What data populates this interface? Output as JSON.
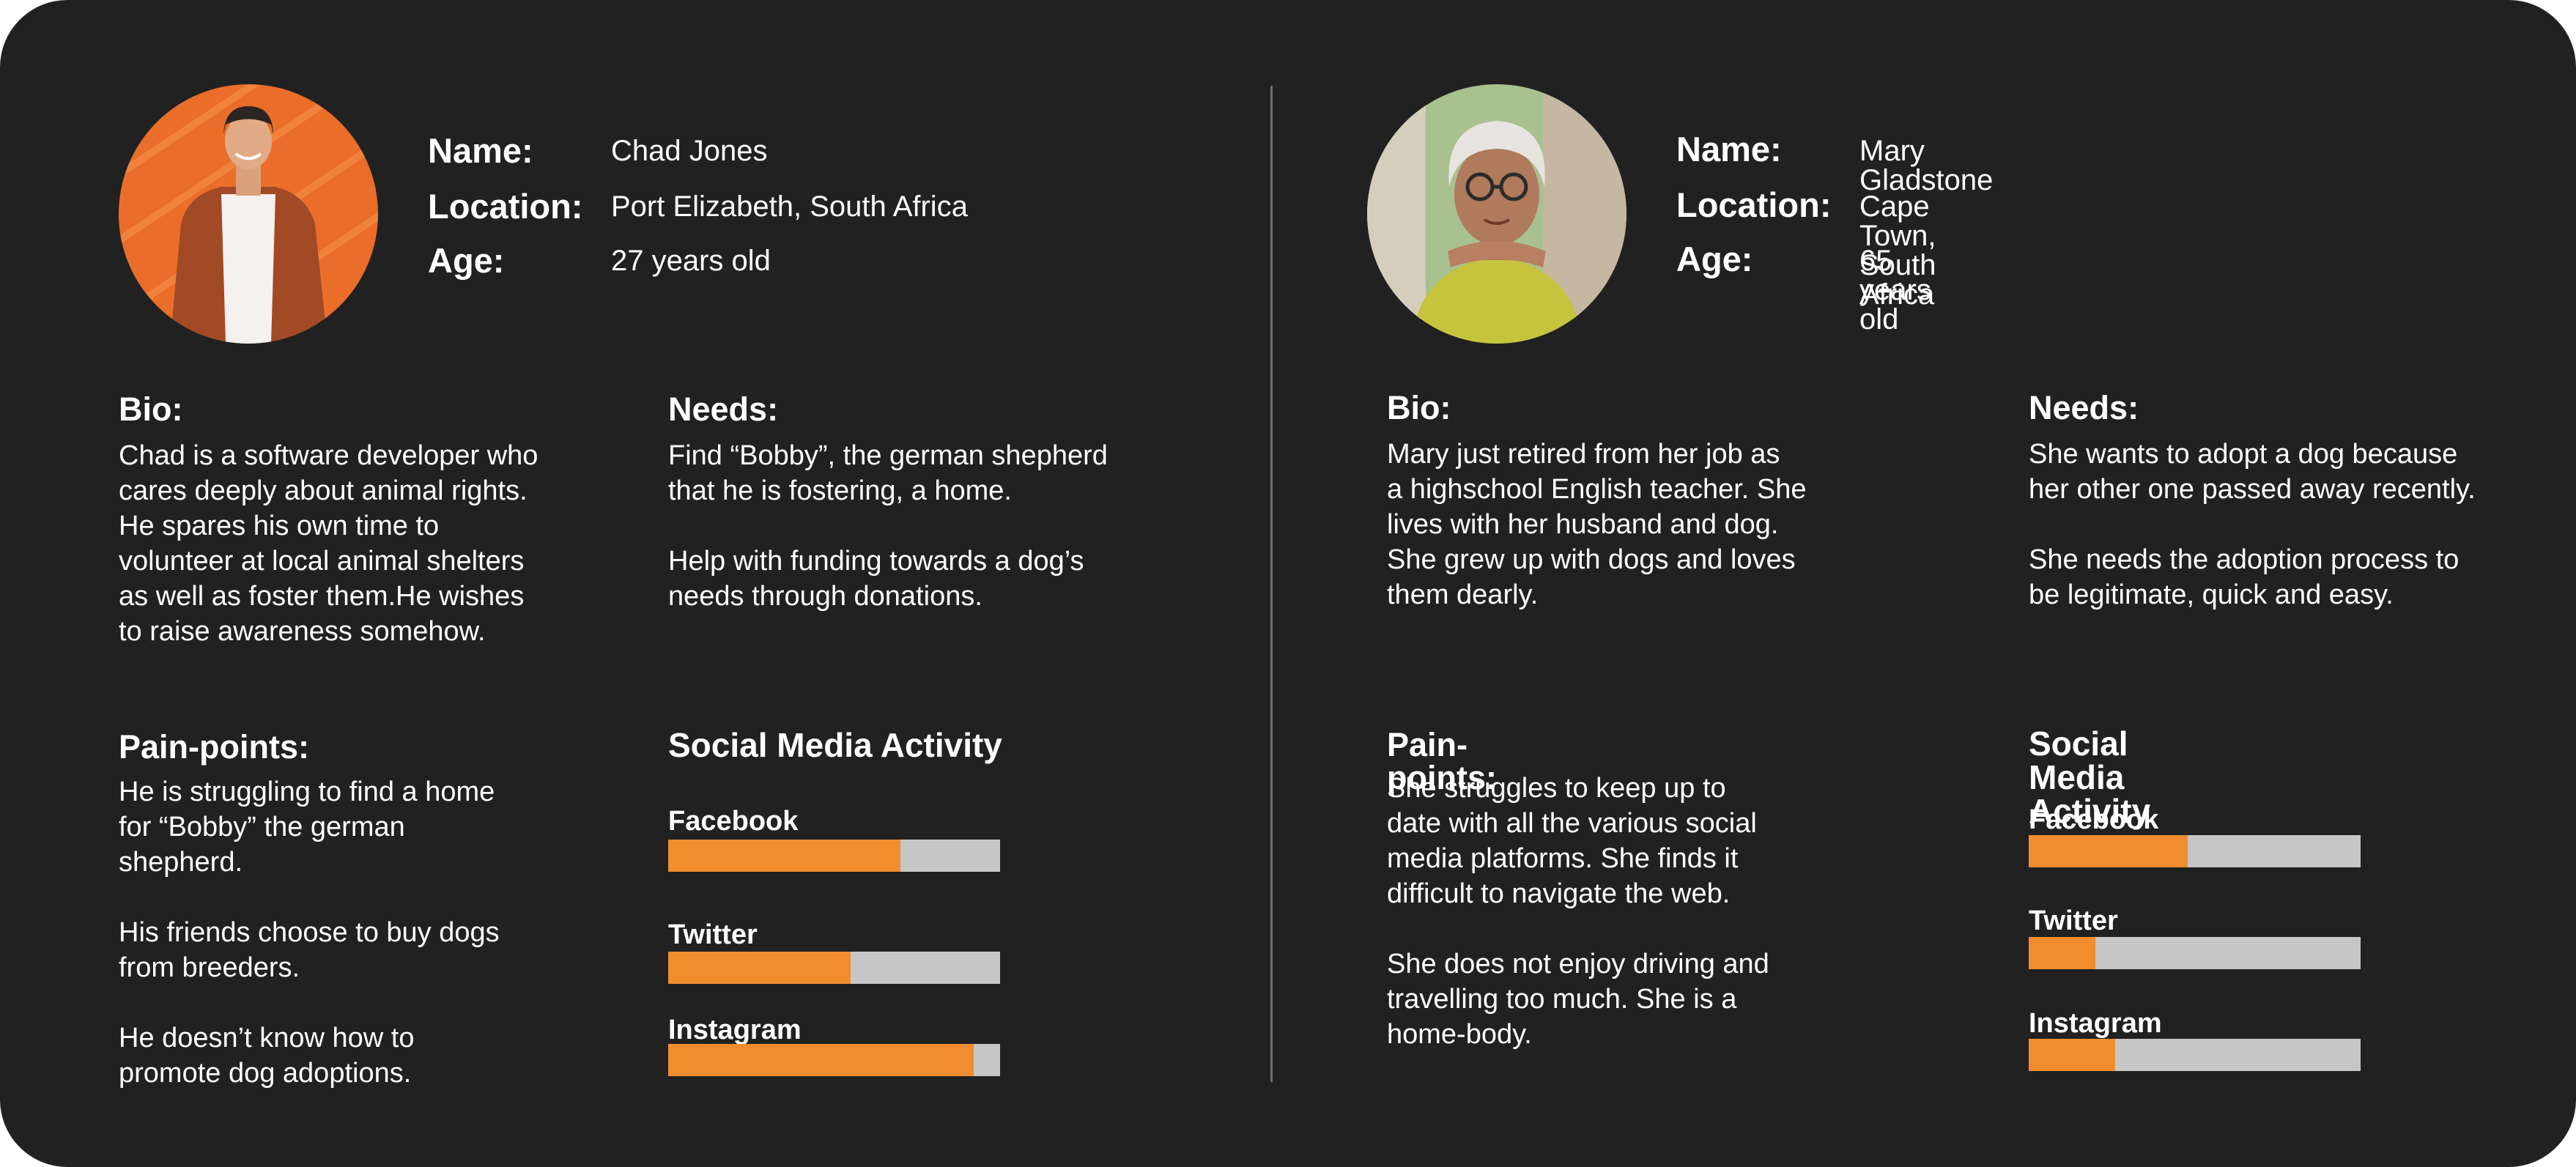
{
  "colors": {
    "background": "#212121",
    "accent": "#f18c2f",
    "track": "#c6c6c6",
    "text": "#ffffff"
  },
  "personas": [
    {
      "name_label": "Name:",
      "name": "Chad Jones",
      "location_label": "Location:",
      "location": "Port Elizabeth, South Africa",
      "age_label": "Age:",
      "age": "27 years old",
      "bio_label": "Bio:",
      "bio": "Chad is a software developer who\ncares deeply about animal rights.\nHe spares his own time to\nvolunteer at local animal shelters\nas well as foster them.He wishes\nto raise awareness somehow.",
      "needs_label": "Needs:",
      "needs": "Find “Bobby”, the german shepherd\nthat he is fostering, a home.\n\nHelp with funding towards a dog’s\nneeds through donations.",
      "pain_label": "Pain-points:",
      "pain": "He is struggling to find a home\nfor “Bobby” the german\nshepherd.\n\nHis friends choose to buy dogs\nfrom breeders.\n\nHe doesn’t know how to\npromote dog adoptions.",
      "social_label": "Social Media Activity",
      "social": [
        {
          "name": "Facebook",
          "level": 0.7
        },
        {
          "name": "Twitter",
          "level": 0.55
        },
        {
          "name": "Instagram",
          "level": 0.92
        }
      ]
    },
    {
      "name_label": "Name:",
      "name": "Mary Gladstone",
      "location_label": "Location:",
      "location": "Cape Town, South Africa",
      "age_label": "Age:",
      "age": "65 years old",
      "bio_label": "Bio:",
      "bio": "Mary just retired from her job as\na highschool English teacher. She\nlives with her husband and dog.\nShe grew up with dogs and loves\nthem dearly.",
      "needs_label": "Needs:",
      "needs": "She wants to adopt a dog because\nher other one passed away recently.\n\nShe needs the adoption process to\nbe legitimate, quick and easy.",
      "pain_label": "Pain-points:",
      "pain": "She struggles to keep up to\ndate with all the various social\nmedia platforms. She finds it\ndifficult to navigate the web.\n\nShe does not enjoy driving and\ntravelling too much. She is a\nhome-body.",
      "social_label": "Social Media Activity",
      "social": [
        {
          "name": "Facebook",
          "level": 0.48
        },
        {
          "name": "Twitter",
          "level": 0.2
        },
        {
          "name": "Instagram",
          "level": 0.26
        }
      ]
    }
  ]
}
